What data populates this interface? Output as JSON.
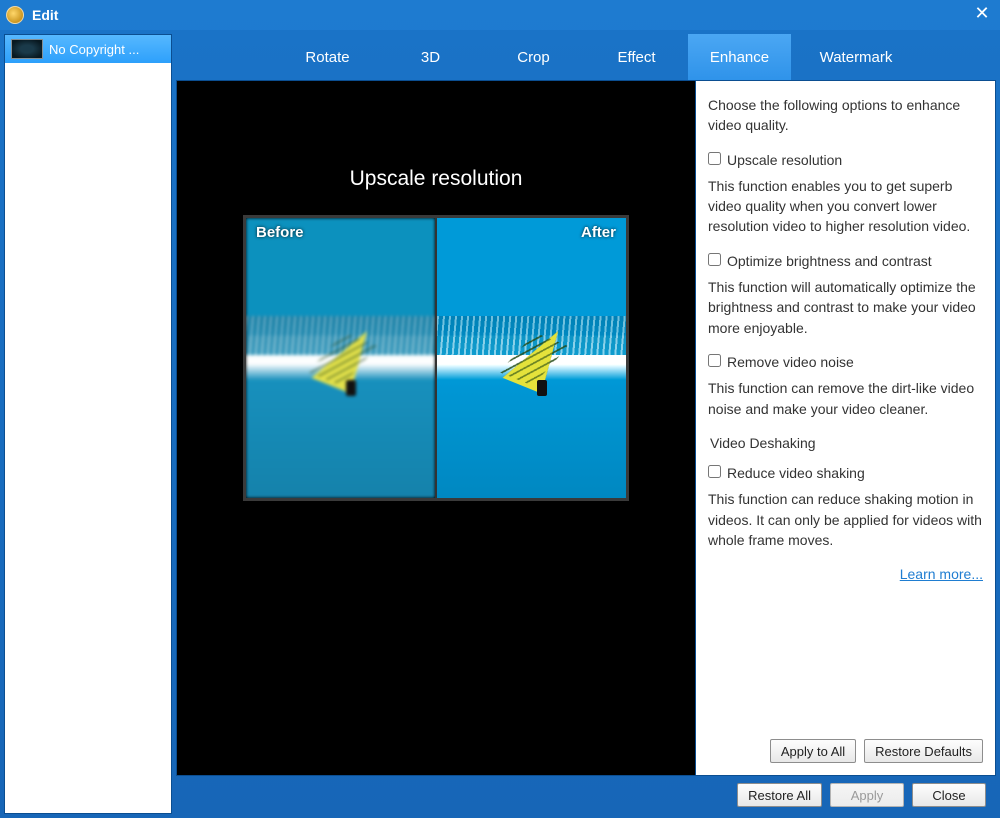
{
  "window": {
    "title": "Edit"
  },
  "sidebar": {
    "items": [
      {
        "label": "No Copyright ..."
      }
    ]
  },
  "tabs": {
    "items": [
      {
        "id": "rotate",
        "label": "Rotate"
      },
      {
        "id": "3d",
        "label": "3D"
      },
      {
        "id": "crop",
        "label": "Crop"
      },
      {
        "id": "effect",
        "label": "Effect"
      },
      {
        "id": "enhance",
        "label": "Enhance"
      },
      {
        "id": "watermark",
        "label": "Watermark"
      }
    ],
    "active": "enhance"
  },
  "preview": {
    "title": "Upscale resolution",
    "before_label": "Before",
    "after_label": "After"
  },
  "panel": {
    "intro": "Choose the following options to enhance video quality.",
    "options": {
      "upscale": {
        "label": "Upscale resolution",
        "desc": "This function enables you to get superb video quality when you convert lower resolution video to higher resolution video."
      },
      "brightness": {
        "label": "Optimize brightness and contrast",
        "desc": "This function will automatically optimize the brightness and contrast to make your video more enjoyable."
      },
      "noise": {
        "label": "Remove video noise",
        "desc": "This function can remove the dirt-like video noise and make your video cleaner."
      },
      "deshake_header": "Video Deshaking",
      "deshake": {
        "label": "Reduce video shaking",
        "desc": "This function can reduce shaking motion in videos. It can only be applied for videos with whole frame moves."
      }
    },
    "learn_more": "Learn more...",
    "buttons": {
      "apply_to_all": "Apply to All",
      "restore_defaults": "Restore Defaults"
    }
  },
  "footer": {
    "restore_all": "Restore All",
    "apply": "Apply",
    "close": "Close"
  }
}
